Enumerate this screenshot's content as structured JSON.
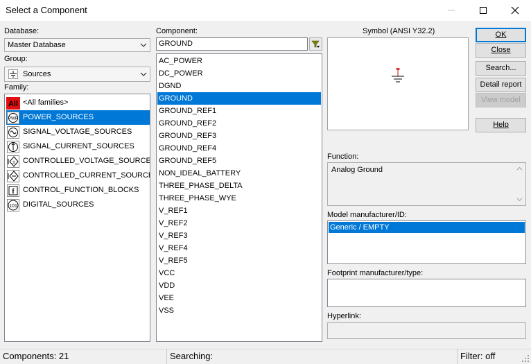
{
  "window": {
    "title": "Select a Component"
  },
  "database": {
    "label": "Database:",
    "value": "Master Database"
  },
  "group": {
    "label": "Group:",
    "value": "Sources",
    "icon": "ground-symbol-icon"
  },
  "family": {
    "label": "Family:",
    "items": [
      {
        "label": "<All families>",
        "icon": "all-families-icon"
      },
      {
        "label": "POWER_SOURCES",
        "icon": "power-sources-icon",
        "selected": true
      },
      {
        "label": "SIGNAL_VOLTAGE_SOURCES",
        "icon": "signal-voltage-icon"
      },
      {
        "label": "SIGNAL_CURRENT_SOURCES",
        "icon": "signal-current-icon"
      },
      {
        "label": "CONTROLLED_VOLTAGE_SOURCES",
        "icon": "controlled-voltage-icon"
      },
      {
        "label": "CONTROLLED_CURRENT_SOURCES",
        "icon": "controlled-current-icon"
      },
      {
        "label": "CONTROL_FUNCTION_BLOCKS",
        "icon": "control-function-icon"
      },
      {
        "label": "DIGITAL_SOURCES",
        "icon": "digital-sources-icon"
      }
    ]
  },
  "component": {
    "label": "Component:",
    "search_value": "GROUND",
    "items": [
      "AC_POWER",
      "DC_POWER",
      "DGND",
      "GROUND",
      "GROUND_REF1",
      "GROUND_REF2",
      "GROUND_REF3",
      "GROUND_REF4",
      "GROUND_REF5",
      "NON_IDEAL_BATTERY",
      "THREE_PHASE_DELTA",
      "THREE_PHASE_WYE",
      "V_REF1",
      "V_REF2",
      "V_REF3",
      "V_REF4",
      "V_REF5",
      "VCC",
      "VDD",
      "VEE",
      "VSS"
    ],
    "selected_index": 3
  },
  "symbol": {
    "label": "Symbol (ANSI Y32.2)"
  },
  "function": {
    "label": "Function:",
    "value": "Analog Ground"
  },
  "model": {
    "label": "Model manufacturer/ID:",
    "value": "Generic / EMPTY"
  },
  "footprint": {
    "label": "Footprint manufacturer/type:"
  },
  "hyperlink": {
    "label": "Hyperlink:"
  },
  "buttons": {
    "ok": "OK",
    "close": "Close",
    "search": "Search...",
    "detail_report": "Detail report",
    "view_model": "View model",
    "help": "Help"
  },
  "status": {
    "components": "Components: 21",
    "searching": "Searching:",
    "filter": "Filter: off"
  },
  "colors": {
    "selection": "#0078d7",
    "accent_red": "#e01010",
    "symbol_red": "#d00000"
  }
}
